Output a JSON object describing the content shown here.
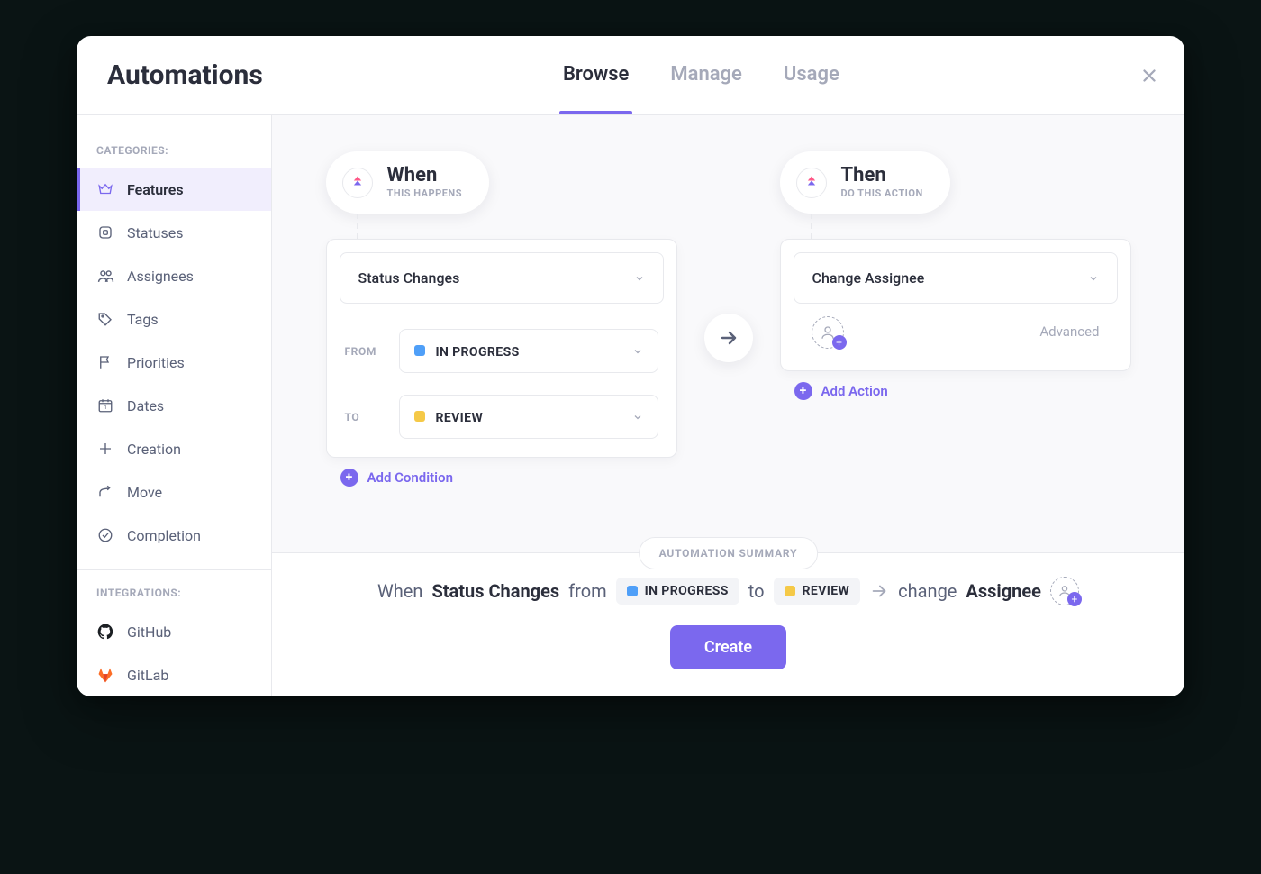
{
  "header": {
    "title": "Automations",
    "tabs": [
      {
        "label": "Browse",
        "active": true
      },
      {
        "label": "Manage",
        "active": false
      },
      {
        "label": "Usage",
        "active": false
      }
    ]
  },
  "sidebar": {
    "categories_title": "CATEGORIES:",
    "integrations_title": "INTEGRATIONS:",
    "categories": [
      {
        "label": "Features",
        "icon": "crown",
        "active": true
      },
      {
        "label": "Statuses",
        "icon": "square",
        "active": false
      },
      {
        "label": "Assignees",
        "icon": "people",
        "active": false
      },
      {
        "label": "Tags",
        "icon": "tag",
        "active": false
      },
      {
        "label": "Priorities",
        "icon": "flag",
        "active": false
      },
      {
        "label": "Dates",
        "icon": "calendar",
        "active": false
      },
      {
        "label": "Creation",
        "icon": "plus",
        "active": false
      },
      {
        "label": "Move",
        "icon": "share",
        "active": false
      },
      {
        "label": "Completion",
        "icon": "check-circle",
        "active": false
      }
    ],
    "integrations": [
      {
        "label": "GitHub",
        "icon": "github"
      },
      {
        "label": "GitLab",
        "icon": "gitlab"
      }
    ]
  },
  "builder": {
    "when": {
      "title": "When",
      "subtitle": "THIS HAPPENS",
      "trigger": "Status Changes",
      "from_label": "FROM",
      "to_label": "TO",
      "from_value": "IN PROGRESS",
      "from_color": "#4F9FF8",
      "to_value": "REVIEW",
      "to_color": "#F5C947",
      "add_condition": "Add Condition"
    },
    "then": {
      "title": "Then",
      "subtitle": "DO THIS ACTION",
      "action": "Change Assignee",
      "advanced_label": "Advanced",
      "add_action": "Add Action"
    }
  },
  "summary": {
    "badge": "AUTOMATION SUMMARY",
    "words": {
      "when": "When",
      "trigger": "Status Changes",
      "from": "from",
      "to": "to",
      "change": "change",
      "assignee": "Assignee"
    },
    "from_value": "IN PROGRESS",
    "to_value": "REVIEW",
    "create": "Create"
  }
}
